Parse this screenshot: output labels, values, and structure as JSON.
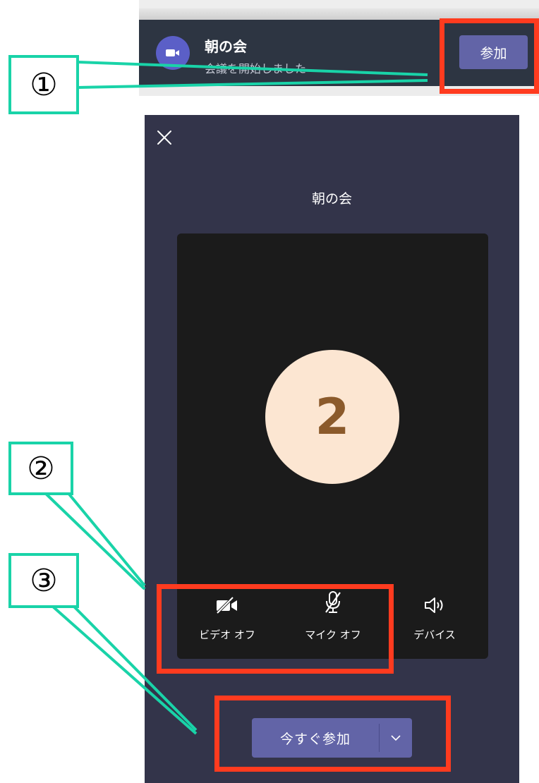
{
  "notification": {
    "title": "朝の会",
    "subtitle": "会議を開始しました",
    "join_label": "参加"
  },
  "meeting": {
    "title": "朝の会",
    "participant_avatar": "2",
    "controls": [
      {
        "label": "ビデオ オフ",
        "icon": "video-off-icon"
      },
      {
        "label": "マイク オフ",
        "icon": "mic-off-icon"
      },
      {
        "label": "デバイス",
        "icon": "speaker-icon"
      }
    ],
    "join_now_label": "今すぐ参加"
  },
  "annotations": {
    "callout_1": "①",
    "callout_2": "②",
    "callout_3": "③",
    "highlight_color": "#ff3b1f",
    "leader_color": "#19d3a8"
  },
  "colors": {
    "accent": "#6264a7",
    "panel_bg": "#33344a",
    "banner_bg": "#2d3542",
    "avatar_bg": "#fce6d2"
  }
}
